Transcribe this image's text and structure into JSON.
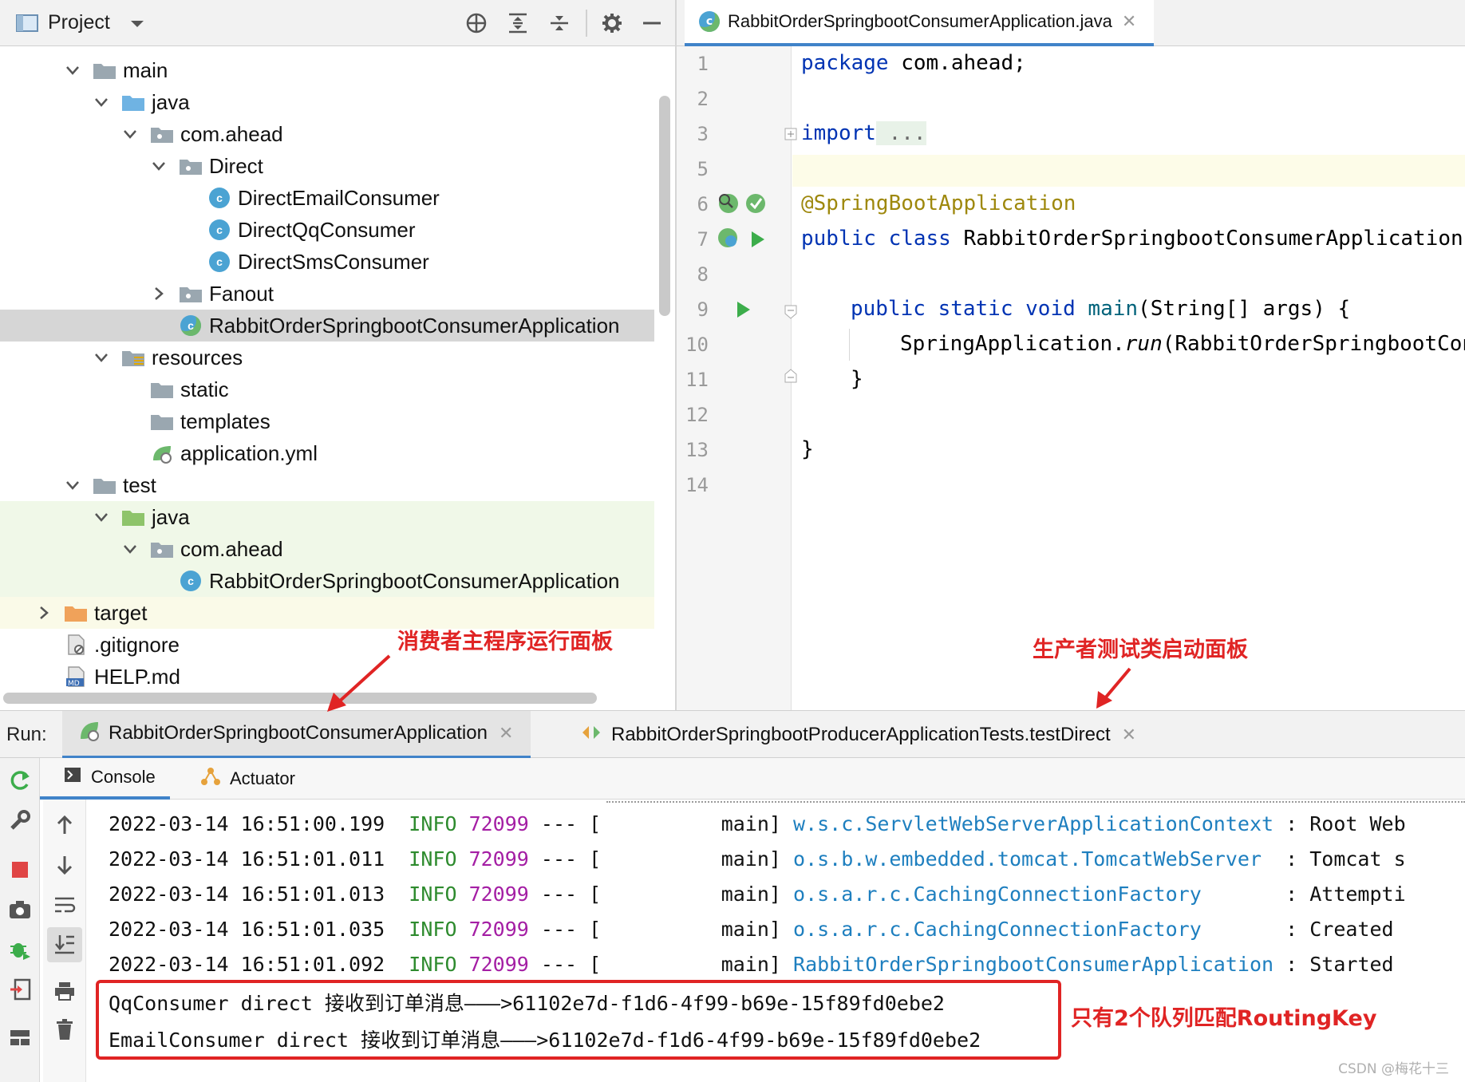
{
  "project_panel": {
    "title": "Project",
    "tree": [
      {
        "label": "main",
        "type": "folder"
      },
      {
        "label": "java",
        "type": "source-folder"
      },
      {
        "label": "com.ahead",
        "type": "package"
      },
      {
        "label": "Direct",
        "type": "package"
      },
      {
        "label": "DirectEmailConsumer",
        "type": "class"
      },
      {
        "label": "DirectQqConsumer",
        "type": "class"
      },
      {
        "label": "DirectSmsConsumer",
        "type": "class"
      },
      {
        "label": "Fanout",
        "type": "package"
      },
      {
        "label": "RabbitOrderSpringbootConsumerApplication",
        "type": "spring-class",
        "selected": true
      },
      {
        "label": "resources",
        "type": "resources-folder"
      },
      {
        "label": "static",
        "type": "folder"
      },
      {
        "label": "templates",
        "type": "folder"
      },
      {
        "label": "application.yml",
        "type": "yml"
      },
      {
        "label": "test",
        "type": "folder"
      },
      {
        "label": "java",
        "type": "test-folder"
      },
      {
        "label": "com.ahead",
        "type": "package"
      },
      {
        "label": "RabbitOrderSpringbootConsumerApplication",
        "type": "class"
      },
      {
        "label": "target",
        "type": "excluded-folder"
      },
      {
        "label": ".gitignore",
        "type": "file"
      },
      {
        "label": "HELP.md",
        "type": "md"
      }
    ]
  },
  "editor": {
    "tab_label": "RabbitOrderSpringbootConsumerApplication.java",
    "line_numbers": [
      "1",
      "2",
      "3",
      "5",
      "6",
      "7",
      "8",
      "9",
      "10",
      "11",
      "12",
      "13",
      "14"
    ],
    "code": {
      "l1_kw": "package",
      "l1_rest": " com.ahead;",
      "l3_kw": "import",
      "l3_fold": " ...",
      "l6_ann": "@SpringBootApplication",
      "l7_kw": "public class",
      "l7_rest": " RabbitOrderSpringbootConsumerApplication",
      "l9_kw": "public static void",
      "l9_fn": " main",
      "l9_rest": "(String[] args) {",
      "l10_a": "SpringApplication.",
      "l10_it": "run",
      "l10_b": "(RabbitOrderSpringbootCon",
      "l11": "}",
      "l13": "}"
    }
  },
  "run_panel": {
    "label": "Run:",
    "tabs": [
      {
        "label": "RabbitOrderSpringbootConsumerApplication"
      },
      {
        "label": "RabbitOrderSpringbootProducerApplicationTests.testDirect"
      }
    ],
    "console_tabs": [
      {
        "label": "Console"
      },
      {
        "label": "Actuator"
      }
    ],
    "logs": [
      {
        "ts": "2022-03-14 16:51:00.199",
        "level": "INFO",
        "pid": "72099",
        "sep": "---",
        "thread": "main]",
        "logger": "w.s.c.ServletWebServerApplicationContext",
        "msg": ": Root Web"
      },
      {
        "ts": "2022-03-14 16:51:01.011",
        "level": "INFO",
        "pid": "72099",
        "sep": "---",
        "thread": "main]",
        "logger": "o.s.b.w.embedded.tomcat.TomcatWebServer",
        "msg": ": Tomcat s"
      },
      {
        "ts": "2022-03-14 16:51:01.013",
        "level": "INFO",
        "pid": "72099",
        "sep": "---",
        "thread": "main]",
        "logger": "o.s.a.r.c.CachingConnectionFactory",
        "msg": ": Attempti"
      },
      {
        "ts": "2022-03-14 16:51:01.035",
        "level": "INFO",
        "pid": "72099",
        "sep": "---",
        "thread": "main]",
        "logger": "o.s.a.r.c.CachingConnectionFactory",
        "msg": ": Created"
      },
      {
        "ts": "2022-03-14 16:51:01.092",
        "level": "INFO",
        "pid": "72099",
        "sep": "---",
        "thread": "main]",
        "logger": "RabbitOrderSpringbootConsumerApplication",
        "msg": ": Started"
      }
    ],
    "messages": [
      "QqConsumer direct 接收到订单消息———>61102e7d-f1d6-4f99-b69e-15f89fd0ebe2",
      "EmailConsumer direct 接收到订单消息———>61102e7d-f1d6-4f99-b69e-15f89fd0ebe2"
    ]
  },
  "annotations": {
    "consumer_note": "消费者主程序运行面板",
    "producer_note": "生产者测试类启动面板",
    "queue_note": "只有2个队列匹配RoutingKey",
    "color": "#e02424"
  },
  "watermark": "CSDN @梅花十三",
  "colors": {
    "accent": "#4083c9",
    "keyword": "#0033b3",
    "annotation": "#9e880d",
    "info": "#2e8b2e",
    "pid": "#a41ea4",
    "logger": "#1e7fbf"
  }
}
